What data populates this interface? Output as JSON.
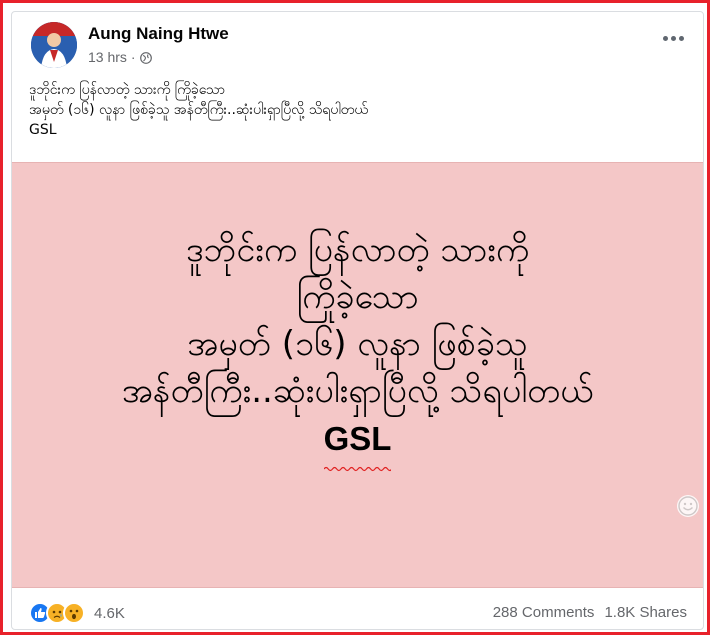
{
  "post": {
    "author": "Aung Naing Htwe",
    "time": "13 hrs",
    "privacy_icon": "globe-icon",
    "menu_icon": "more-options-icon",
    "caption_lines": [
      "ဒူဘိုင်းက ပြန်လာတဲ့ သားကို ကြိုခဲ့သော",
      "အမှတ် (၁၆) လူနာ ဖြစ်ခဲ့သူ အန်တီကြီး..ဆုံးပါးရှာပြီလို့ သိရပါတယ်",
      "GSL"
    ]
  },
  "image": {
    "background": "#f4c7c7",
    "lines": [
      "ဒူဘိုင်းက ပြန်လာတဲ့ သားကို",
      "ကြိုခဲ့သော",
      "အမှတ် (၁၆) လူနာ ဖြစ်ခဲ့သူ",
      "အန်တီကြီး..ဆုံးပါးရှာပြီလို့ သိရပါတယ်",
      "GSL"
    ]
  },
  "footer": {
    "reactions": [
      "like",
      "sad",
      "wow"
    ],
    "reaction_count": "4.6K",
    "comments": "288 Comments",
    "shares": "1.8K Shares"
  },
  "colors": {
    "frame_border": "#e8212b",
    "like_blue": "#1877f2",
    "meta_gray": "#65676b"
  }
}
